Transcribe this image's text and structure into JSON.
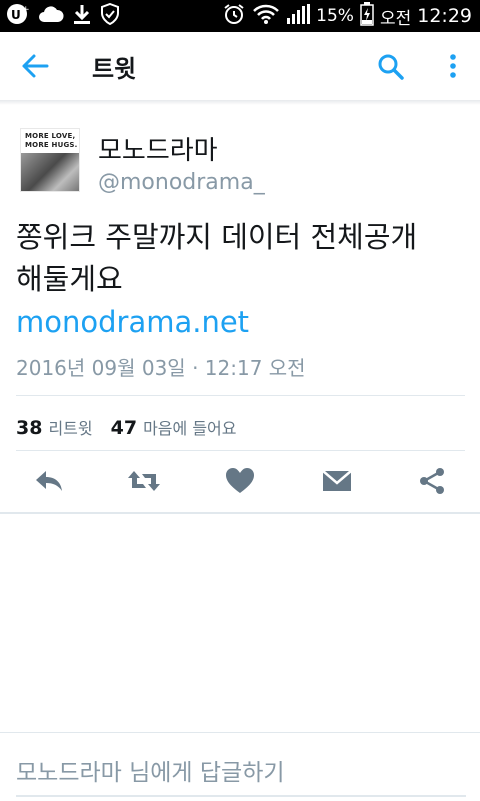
{
  "status_bar": {
    "battery_percent": "15%",
    "carrier_label": "오전",
    "time": "12:29",
    "icons": [
      "u-plus-icon",
      "cloud-icon",
      "download-icon",
      "shield-check-icon",
      "alarm-icon",
      "wifi-icon",
      "signal-icon",
      "battery-charging-icon"
    ]
  },
  "app_bar": {
    "title": "트윗",
    "back_icon": "arrow-left-icon",
    "search_icon": "search-icon",
    "more_icon": "more-vertical-icon",
    "accent_color": "#1da1f2"
  },
  "tweet": {
    "avatar": {
      "tag_line1": "MORE LOVE,",
      "tag_line2": "MORE HUGS."
    },
    "display_name": "모노드라마",
    "handle": "@monodrama_",
    "text_line1": "쫑위크 주말까지 데이터 전체공개",
    "text_line2": "해둘게요",
    "link": "monodrama.net",
    "timestamp": "2016년 09월 03일 · 12:17 오전"
  },
  "stats": {
    "retweets_count": "38",
    "retweets_label": "리트윗",
    "likes_count": "47",
    "likes_label": "마음에 들어요"
  },
  "actions": [
    "reply-icon",
    "retweet-icon",
    "heart-icon",
    "direct-message-icon",
    "share-icon"
  ],
  "reply": {
    "placeholder": "모노드라마 님에게 답글하기"
  },
  "colors": {
    "link": "#1da1f2",
    "secondary_text": "#8899a6",
    "action_icon": "#657786",
    "divider": "#e1e8ed"
  }
}
